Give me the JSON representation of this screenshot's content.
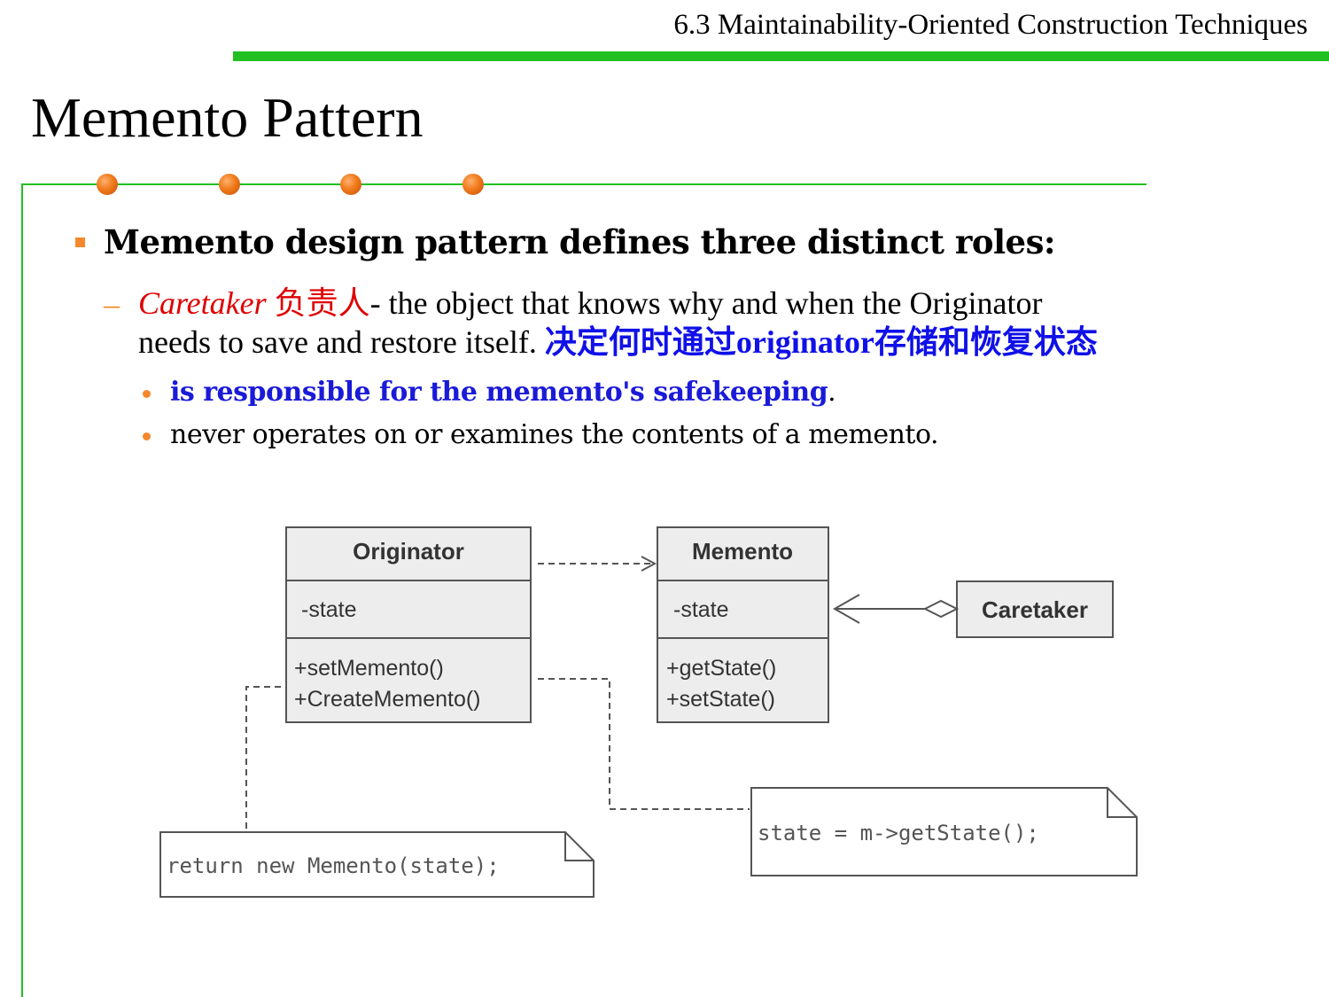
{
  "header": {
    "section_title": "6.3 Maintainability-Oriented Construction Techniques",
    "accent_color": "#22c022"
  },
  "slide": {
    "title": "Memento Pattern",
    "bullet": "Memento design pattern defines three distinct roles:",
    "caretaker": {
      "label": "Caretaker",
      "label_cn": "负责人",
      "desc_line1": "- the object that knows why and when the Originator",
      "desc_line2": "needs to save and restore itself.",
      "desc_cn": "决定何时通过originator存储和恢复状态"
    },
    "sub_bullets": [
      {
        "text": "is responsible for the memento's safekeeping",
        "suffix": "."
      },
      {
        "text": "never operates on or examines the contents of a memento."
      }
    ]
  },
  "diagram": {
    "originator": {
      "name": "Originator",
      "attr": "-state",
      "ops": [
        "+setMemento()",
        "+CreateMemento()"
      ]
    },
    "memento": {
      "name": "Memento",
      "attr": "-state",
      "ops": [
        "+getState()",
        "+setState()"
      ]
    },
    "caretaker": {
      "name": "Caretaker"
    },
    "note_create": "return new Memento(state);",
    "note_set": "state = m->getState();"
  }
}
